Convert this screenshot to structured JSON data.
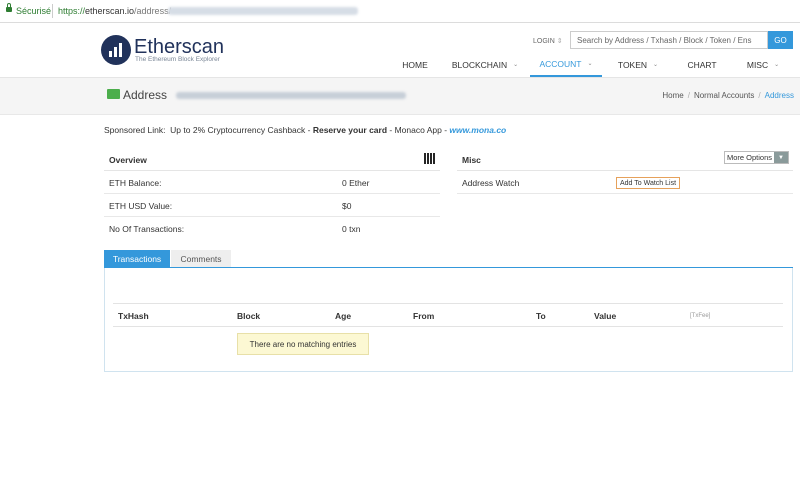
{
  "browser": {
    "secure_label": "Sécurisé",
    "url_scheme": "https://",
    "url_host": "etherscan.io",
    "url_path": "/address/"
  },
  "header": {
    "logo_title": "Etherscan",
    "logo_subtitle": "The Ethereum Block Explorer",
    "login": "LOGIN",
    "search_placeholder": "Search by Address / Txhash / Block / Token / Ens",
    "search_button": "GO",
    "nav": [
      {
        "label": "HOME"
      },
      {
        "label": "BLOCKCHAIN"
      },
      {
        "label": "ACCOUNT"
      },
      {
        "label": "TOKEN"
      },
      {
        "label": "CHART"
      },
      {
        "label": "MISC"
      }
    ]
  },
  "page": {
    "title": "Address",
    "breadcrumb": [
      "Home",
      "Normal Accounts",
      "Address"
    ]
  },
  "sponsored": {
    "prefix": "Sponsored Link:",
    "text": "Up to 2% Cryptocurrency Cashback - ",
    "bold": "Reserve your card",
    "text2": " - Monaco App - ",
    "link": "www.mona.co"
  },
  "overview": {
    "title": "Overview",
    "rows": [
      {
        "label": "ETH Balance:",
        "value": "0 Ether"
      },
      {
        "label": "ETH USD Value:",
        "value": "$0"
      },
      {
        "label": "No Of Transactions:",
        "value": "0 txn"
      }
    ]
  },
  "misc": {
    "title": "Misc",
    "more_options": "More Options",
    "address_watch_label": "Address Watch",
    "add_watch_button": "Add To Watch List"
  },
  "tabs": [
    "Transactions",
    "Comments"
  ],
  "table": {
    "headers": [
      "TxHash",
      "Block",
      "Age",
      "From",
      "To",
      "Value",
      "[TxFee]"
    ],
    "empty_message": "There are no matching entries"
  },
  "colors": {
    "accent": "#3498db",
    "brand": "#21325b",
    "secure": "#2e7d32"
  }
}
